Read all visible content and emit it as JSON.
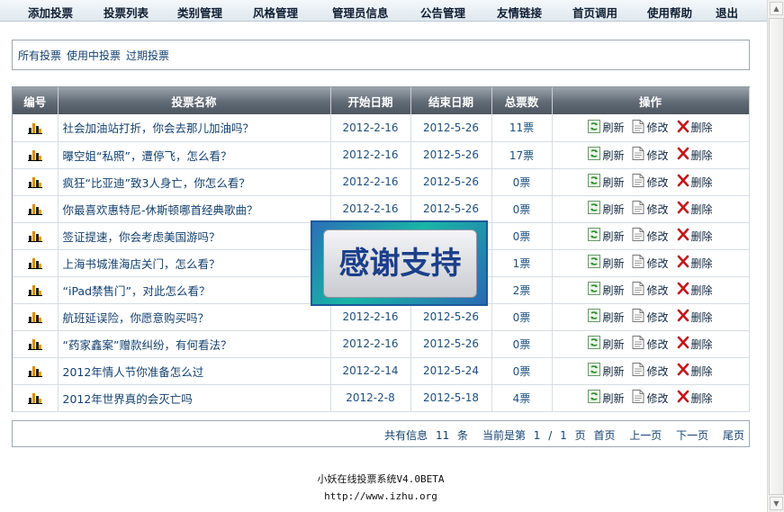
{
  "nav": {
    "items": [
      "添加投票",
      "投票列表",
      "类别管理",
      "风格管理",
      "管理员信息",
      "公告管理",
      "友情链接",
      "首页调用",
      "使用帮助",
      "退出"
    ]
  },
  "filters": [
    "所有投票",
    "使用中投票",
    "过期投票"
  ],
  "table": {
    "headers": [
      "编号",
      "投票名称",
      "开始日期",
      "结束日期",
      "总票数",
      "操作"
    ],
    "rows": [
      {
        "name": "社会加油站打折，你会去那儿加油吗？",
        "start": "2012-2-16",
        "end": "2012-5-26",
        "votes": "11票"
      },
      {
        "name": "曝空姐“私照”，遭停飞，怎么看？",
        "start": "2012-2-16",
        "end": "2012-5-26",
        "votes": "17票"
      },
      {
        "name": "疯狂“比亚迪”致3人身亡，你怎么看？",
        "start": "2012-2-16",
        "end": "2012-5-26",
        "votes": "0票"
      },
      {
        "name": "你最喜欢惠特尼-休斯顿哪首经典歌曲？",
        "start": "2012-2-16",
        "end": "2012-5-26",
        "votes": "0票"
      },
      {
        "name": "签证提速，你会考虑美国游吗？",
        "start": "",
        "end": "",
        "votes": "0票"
      },
      {
        "name": "上海书城淮海店关门，怎么看？",
        "start": "",
        "end": "",
        "votes": "1票"
      },
      {
        "name": "“iPad禁售门”，对此怎么看？",
        "start": "",
        "end": "",
        "votes": "2票"
      },
      {
        "name": "航班延误险，你愿意购买吗？",
        "start": "2012-2-16",
        "end": "2012-5-26",
        "votes": "0票"
      },
      {
        "name": "“药家鑫案”赠款纠纷，有何看法？",
        "start": "2012-2-16",
        "end": "2012-5-26",
        "votes": "0票"
      },
      {
        "name": "2012年情人节你准备怎么过",
        "start": "2012-2-14",
        "end": "2012-5-24",
        "votes": "0票"
      },
      {
        "name": "2012年世界真的会灭亡吗",
        "start": "2012-2-8",
        "end": "2012-5-18",
        "votes": "4票"
      }
    ],
    "actions": {
      "refresh": "刷新",
      "edit": "修改",
      "delete": "删除"
    }
  },
  "pager": {
    "total_text": "共有信息",
    "total": "11",
    "unit": "条",
    "current_text": "当前是第",
    "page": "1",
    "slash": "/",
    "pages": "1",
    "page_unit": "页",
    "first": "首页",
    "prev": "上一页",
    "next": "下一页",
    "last": "尾页"
  },
  "footer": {
    "copyright": "小妖在线投票系统V4.0BETA",
    "url": "http://www.izhu.org"
  },
  "overlay": {
    "text": "感谢支持"
  },
  "colors": {
    "header_bg": "#616b75",
    "link": "#13406e",
    "delete_red": "#c4161c",
    "refresh_green": "#2e8b2e"
  }
}
